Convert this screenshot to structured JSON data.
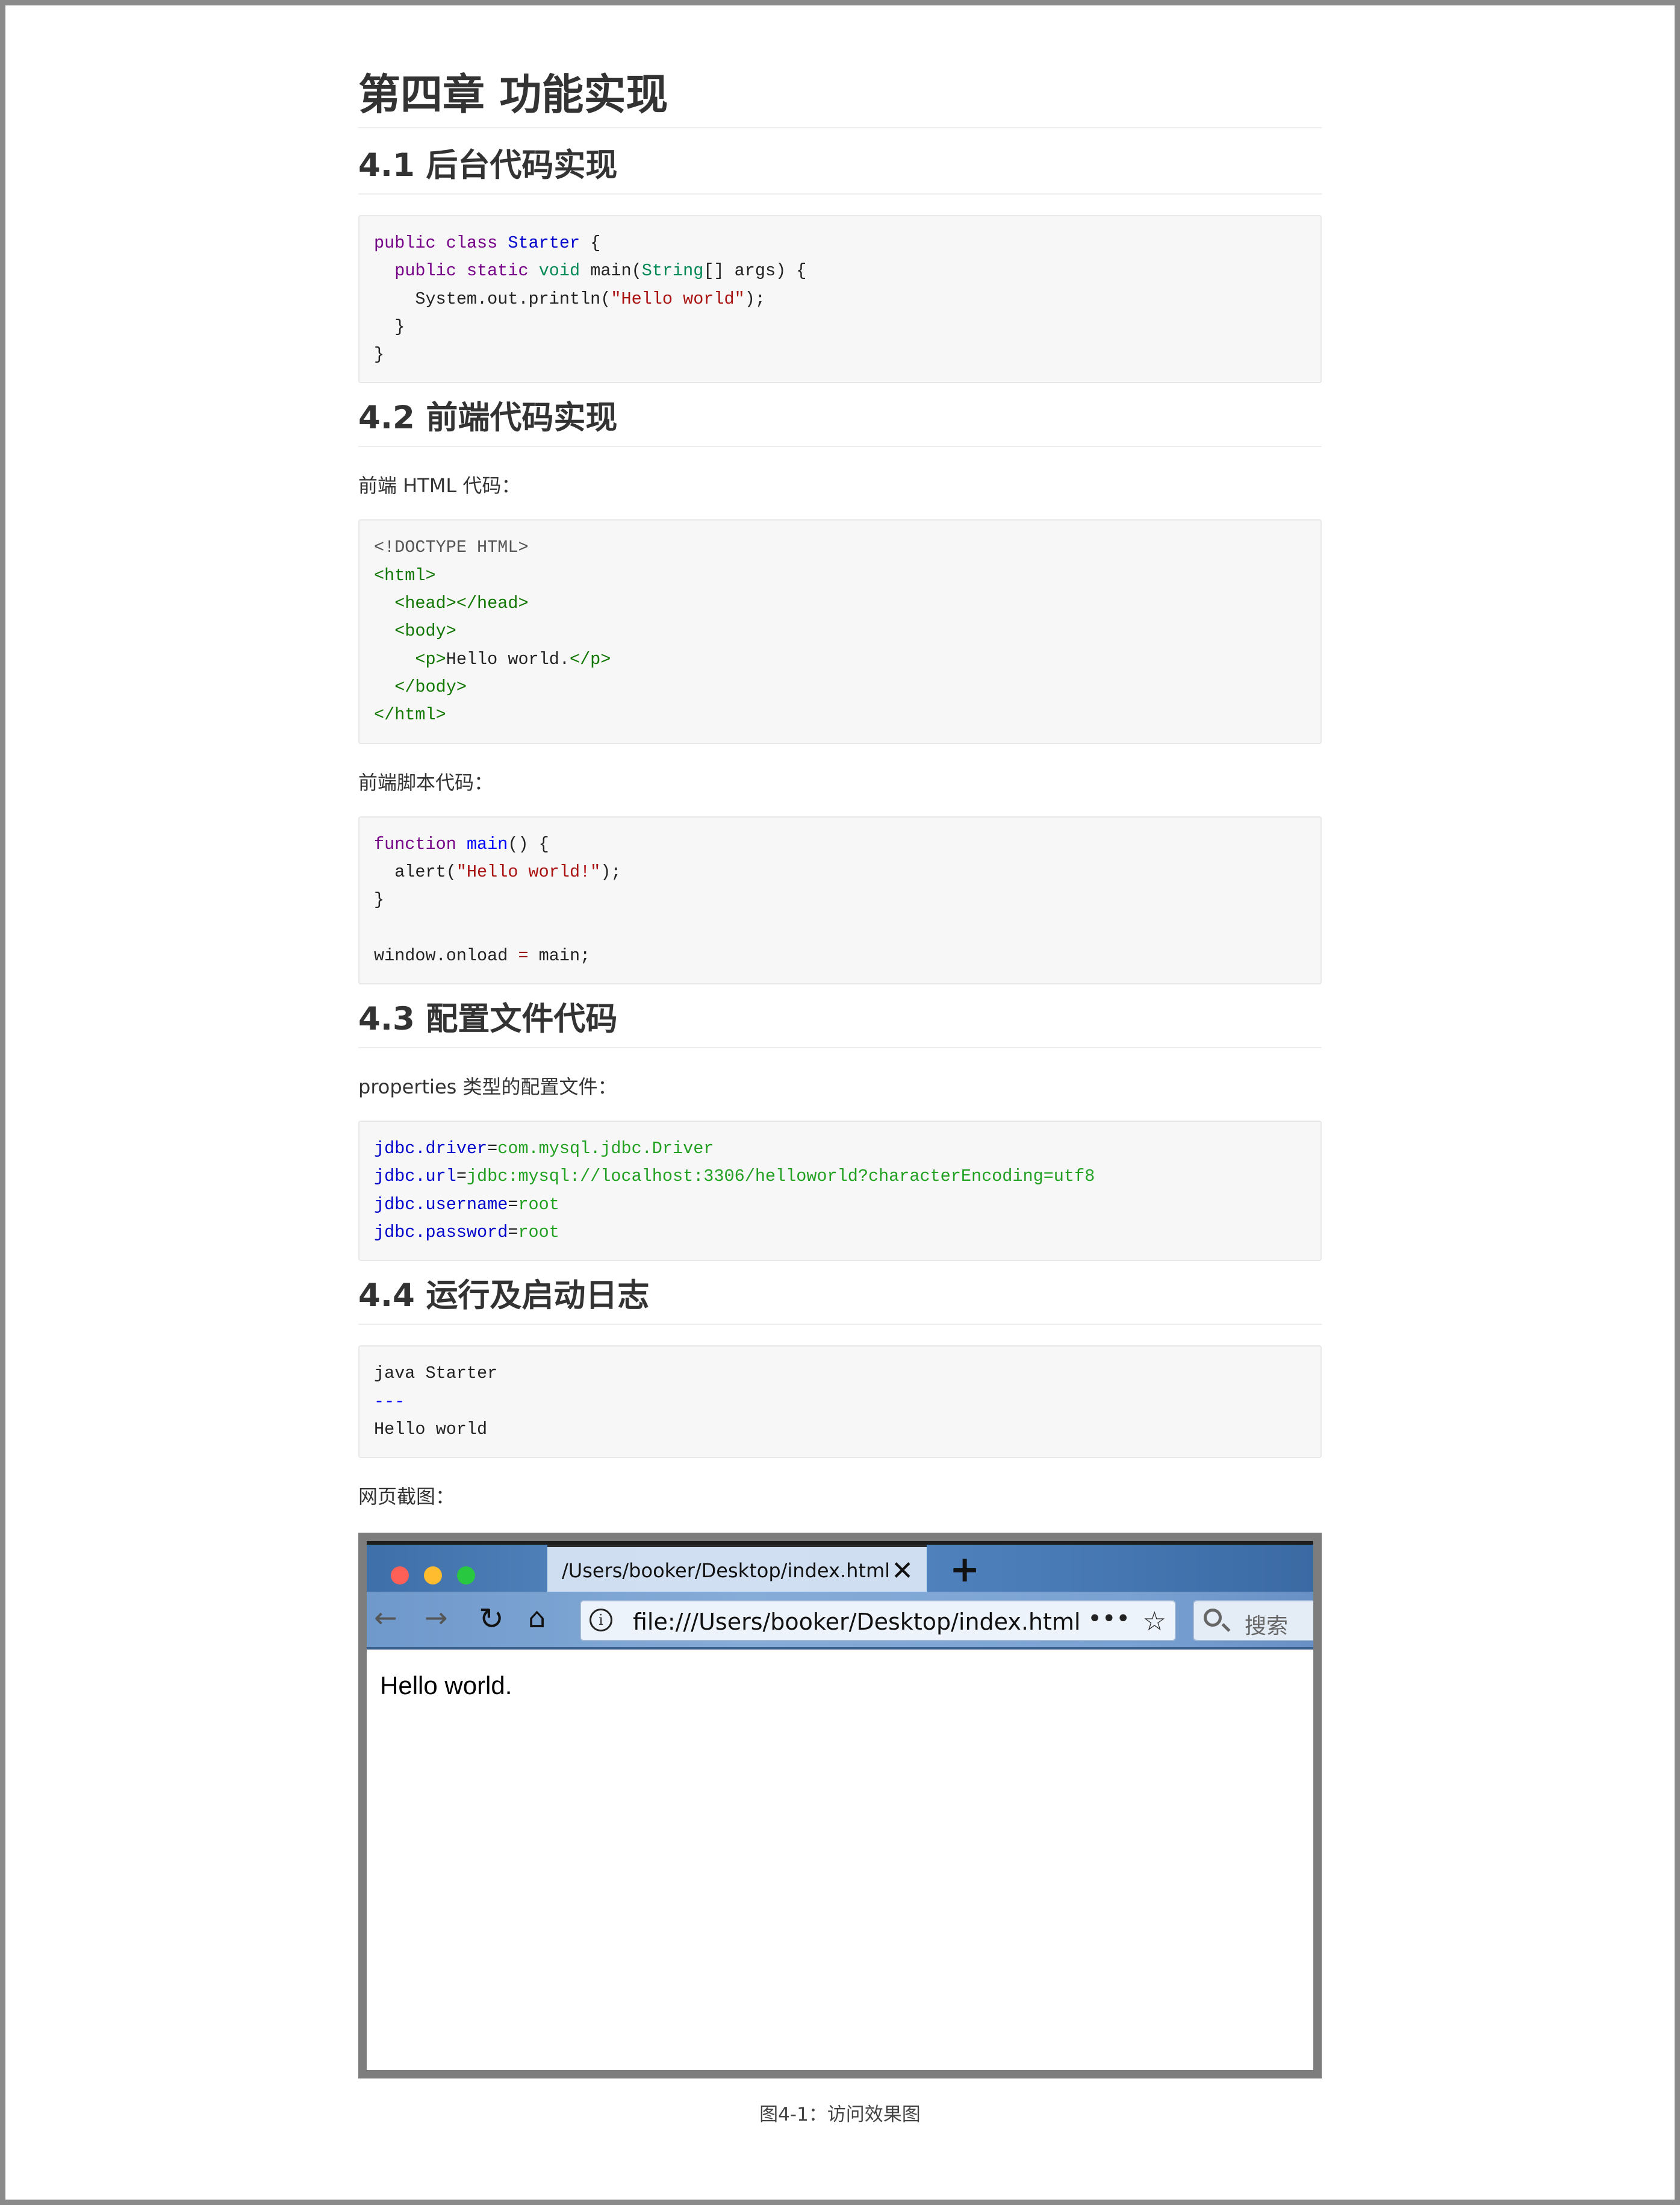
{
  "chapter_title": "第四章 功能实现",
  "sections": {
    "s1": {
      "title": "4.1 后台代码实现"
    },
    "s2": {
      "title": "4.2 前端代码实现",
      "html_label": "前端 HTML 代码：",
      "script_label": "前端脚本代码："
    },
    "s3": {
      "title": "4.3 配置文件代码",
      "props_label": "properties 类型的配置文件："
    },
    "s4": {
      "title": "4.4 运行及启动日志",
      "screenshot_label": "网页截图："
    }
  },
  "code": {
    "java": {
      "l1": [
        "public",
        "class",
        "Starter",
        " {"
      ],
      "l2": [
        "  ",
        "public",
        "static",
        "void",
        "main(",
        "String",
        "[] args) {"
      ],
      "l3": [
        "    System.out.println(",
        "\"Hello world\"",
        ");"
      ],
      "l4": "  }",
      "l5": "}"
    },
    "html": {
      "l1": "<!DOCTYPE HTML>",
      "l2": "<html>",
      "l3a": "<head>",
      "l3b": "</head>",
      "l4": "<body>",
      "l5a": "<p>",
      "l5b": "Hello world.",
      "l5c": "</p>",
      "l6": "</body>",
      "l7": "</html>"
    },
    "js": {
      "l1a": "function",
      "l1b": "main",
      "l1c": "() {",
      "l2a": "  alert(",
      "l2b": "\"Hello world!\"",
      "l2c": ");",
      "l3": "}",
      "l5a": "window.onload ",
      "l5b": "=",
      "l5c": " main;"
    },
    "props": [
      {
        "key": "jdbc.driver",
        "eq": "=",
        "val": "com.mysql.jdbc.Driver"
      },
      {
        "key": "jdbc.url",
        "eq": "=",
        "val": "jdbc:mysql://localhost:3306/helloworld?characterEncoding=utf8"
      },
      {
        "key": "jdbc.username",
        "eq": "=",
        "val": "root"
      },
      {
        "key": "jdbc.password",
        "eq": "=",
        "val": "root"
      }
    ],
    "log": {
      "l1": "java Starter",
      "l2": "---",
      "l3": "Hello world"
    }
  },
  "browser": {
    "tab_title": "/Users/booker/Desktop/index.html",
    "url": "file:///Users/booker/Desktop/index.html",
    "search_placeholder": "搜索",
    "page_text": "Hello world.",
    "icons": [
      "back-arrow-icon",
      "forward-arrow-icon",
      "reload-icon",
      "home-icon",
      "info-icon",
      "more-icon",
      "star-icon",
      "search-icon",
      "close-icon",
      "plus-icon"
    ]
  },
  "figure_caption": "图4-1：访问效果图"
}
